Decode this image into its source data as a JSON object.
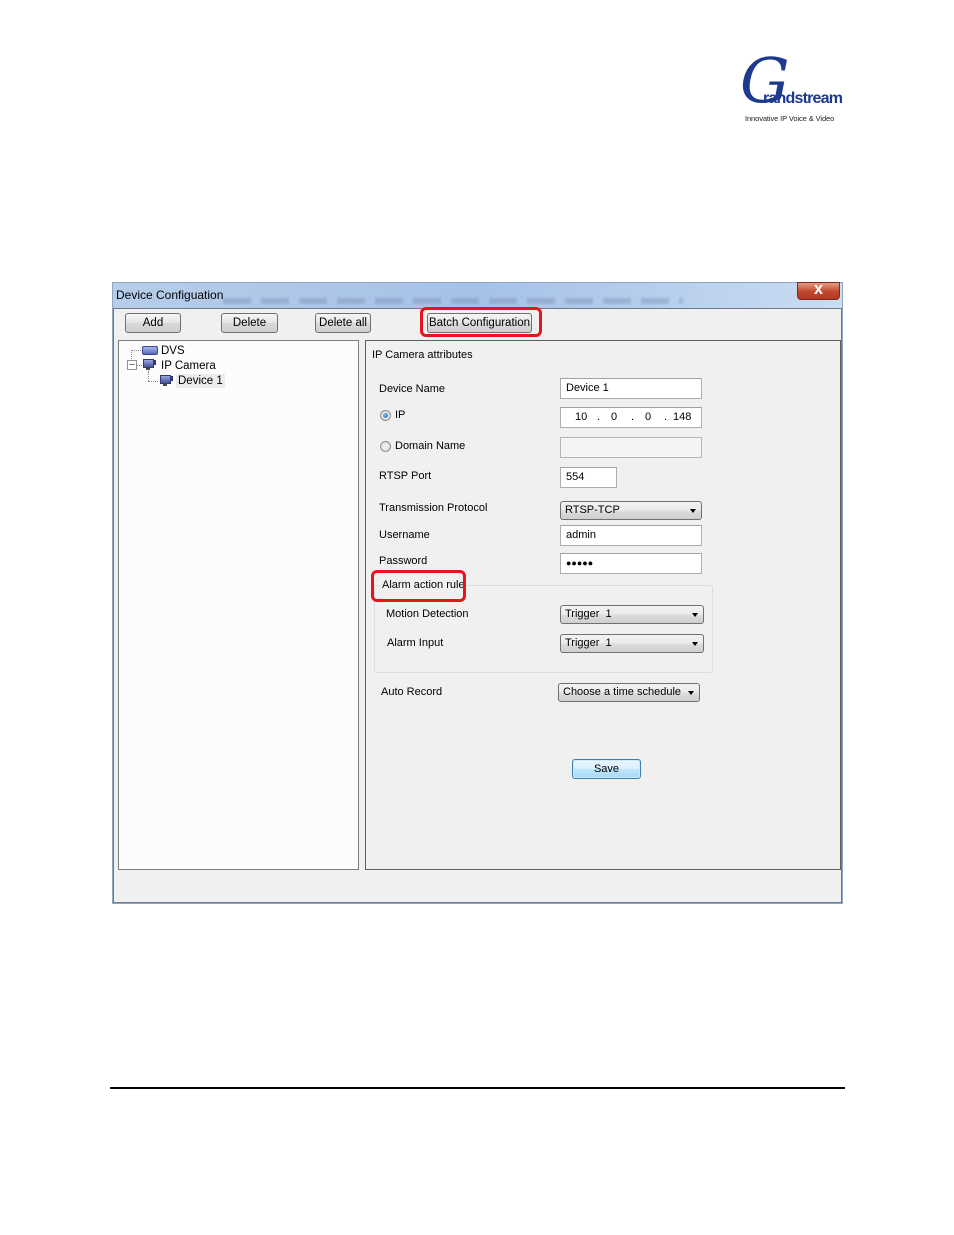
{
  "logo": {
    "letter": "G",
    "wordmark": "randstream",
    "tagline": "Innovative IP Voice & Video"
  },
  "window": {
    "title": "Device Configuation",
    "close_label": "X"
  },
  "toolbar": {
    "add_label": "Add",
    "delete_label": "Delete",
    "delete_all_label": "Delete all",
    "batch_label": "Batch Configuration"
  },
  "tree": {
    "items": [
      {
        "label": "DVS",
        "icon": "dvs-icon"
      },
      {
        "label": "IP Camera",
        "icon": "camera-icon",
        "expander": "−"
      },
      {
        "label": "Device 1",
        "icon": "camera-icon",
        "selected": true
      }
    ]
  },
  "attributes": {
    "section_title": "IP Camera attributes",
    "device_name": {
      "label": "Device Name",
      "value": "Device 1"
    },
    "ip": {
      "label": "IP",
      "selected": true,
      "octets": [
        "10",
        "0",
        "0",
        "148"
      ],
      "separator": "."
    },
    "domain_name": {
      "label": "Domain Name",
      "selected": false,
      "value": ""
    },
    "rtsp_port": {
      "label": "RTSP Port",
      "value": "554"
    },
    "transmission_protocol": {
      "label": "Transmission Protocol",
      "value": "RTSP-TCP"
    },
    "username": {
      "label": "Username",
      "value": "admin"
    },
    "password": {
      "label": "Password",
      "value": "●●●●●"
    },
    "alarm_group": {
      "title": "Alarm action rule",
      "motion_detection": {
        "label": "Motion Detection",
        "value": "Trigger  1"
      },
      "alarm_input": {
        "label": "Alarm Input",
        "value": "Trigger  1"
      }
    },
    "auto_record": {
      "label": "Auto Record",
      "value": "Choose a time schedule"
    },
    "save_label": "Save"
  },
  "highlight_color": "#e8141b"
}
